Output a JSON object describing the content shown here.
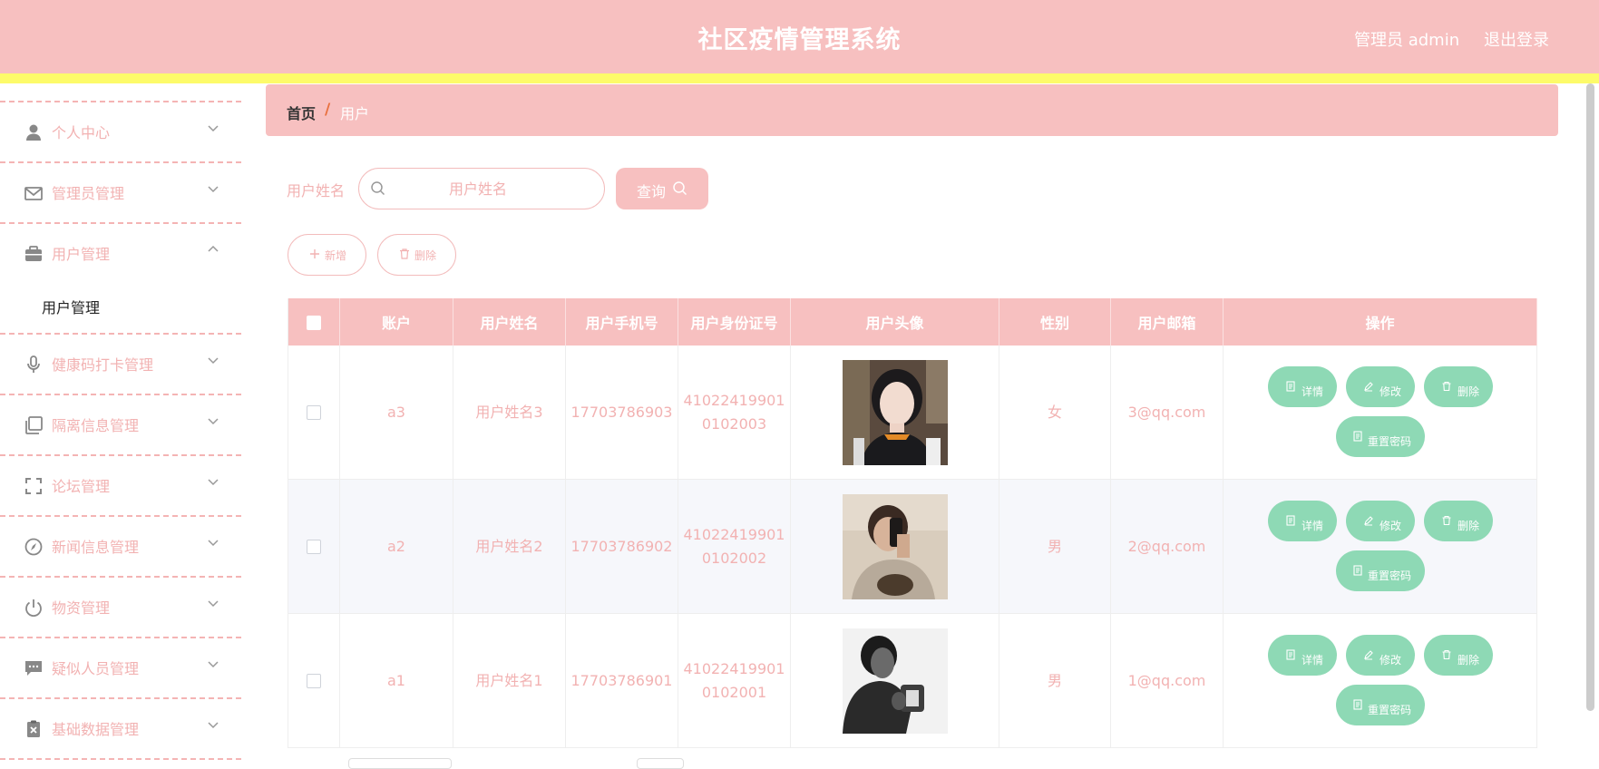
{
  "header": {
    "title": "社区疫情管理系统",
    "user_label": "管理员 admin",
    "logout_label": "退出登录"
  },
  "sidebar": {
    "items": [
      {
        "label": "个人中心",
        "icon": "user-icon",
        "expanded": false
      },
      {
        "label": "管理员管理",
        "icon": "mail-icon",
        "expanded": false
      },
      {
        "label": "用户管理",
        "icon": "briefcase-icon",
        "expanded": true
      },
      {
        "label": "健康码打卡管理",
        "icon": "microphone-icon",
        "expanded": false
      },
      {
        "label": "隔离信息管理",
        "icon": "copy-icon",
        "expanded": false
      },
      {
        "label": "论坛管理",
        "icon": "fullscreen-icon",
        "expanded": false
      },
      {
        "label": "新闻信息管理",
        "icon": "compass-icon",
        "expanded": false
      },
      {
        "label": "物资管理",
        "icon": "power-icon",
        "expanded": false
      },
      {
        "label": "疑似人员管理",
        "icon": "chat-icon",
        "expanded": false
      },
      {
        "label": "基础数据管理",
        "icon": "clipboard-x-icon",
        "expanded": false
      }
    ],
    "subitem": "用户管理"
  },
  "breadcrumb": {
    "home": "首页",
    "separator": "/",
    "current": "用户"
  },
  "search": {
    "label": "用户姓名",
    "placeholder": "用户姓名",
    "value": "",
    "query_label": "查询"
  },
  "actions": {
    "add_label": "新增",
    "delete_label": "删除"
  },
  "table": {
    "columns": [
      "账户",
      "用户姓名",
      "用户手机号",
      "用户身份证号",
      "用户头像",
      "性别",
      "用户邮箱",
      "操作"
    ],
    "rows": [
      {
        "account": "a3",
        "name": "用户姓名3",
        "phone": "17703786903",
        "id_line1": "41022419901",
        "id_line2": "0102003",
        "gender": "女",
        "email": "3@qq.com"
      },
      {
        "account": "a2",
        "name": "用户姓名2",
        "phone": "17703786902",
        "id_line1": "41022419901",
        "id_line2": "0102002",
        "gender": "男",
        "email": "2@qq.com"
      },
      {
        "account": "a1",
        "name": "用户姓名1",
        "phone": "17703786901",
        "id_line1": "41022419901",
        "id_line2": "0102001",
        "gender": "男",
        "email": "1@qq.com"
      }
    ],
    "op_labels": {
      "detail": "详情",
      "edit": "修改",
      "delete": "删除",
      "reset": "重置密码"
    }
  },
  "colors": {
    "header_bg": "#f7c0c0",
    "accent_strip": "#fdfb6a",
    "op_button": "#8ed9b5",
    "muted_text": "#f2b2b2"
  }
}
